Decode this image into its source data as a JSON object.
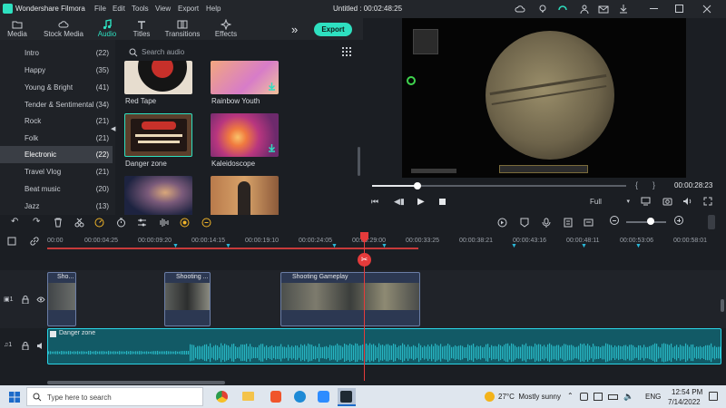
{
  "app": {
    "name": "Wondershare Filmora",
    "menu": [
      "File",
      "Edit",
      "Tools",
      "View",
      "Export",
      "Help"
    ],
    "project_title": "Untitled : 00:02:48:25"
  },
  "tabs": [
    {
      "label": "Media",
      "icon": "folder-icon"
    },
    {
      "label": "Stock Media",
      "icon": "cloud-icon"
    },
    {
      "label": "Audio",
      "icon": "music-note-icon"
    },
    {
      "label": "Titles",
      "icon": "text-icon"
    },
    {
      "label": "Transitions",
      "icon": "transition-icon"
    },
    {
      "label": "Effects",
      "icon": "sparkle-icon"
    }
  ],
  "export_label": "Export",
  "search_placeholder": "Search audio",
  "categories": [
    {
      "name": "Intro",
      "count": "(22)"
    },
    {
      "name": "Happy",
      "count": "(35)"
    },
    {
      "name": "Young & Bright",
      "count": "(41)"
    },
    {
      "name": "Tender & Sentimental",
      "count": "(34)"
    },
    {
      "name": "Rock",
      "count": "(21)"
    },
    {
      "name": "Folk",
      "count": "(21)"
    },
    {
      "name": "Electronic",
      "count": "(22)"
    },
    {
      "name": "Travel Vlog",
      "count": "(21)"
    },
    {
      "name": "Beat music",
      "count": "(20)"
    },
    {
      "name": "Jazz",
      "count": "(13)"
    }
  ],
  "audio_items": [
    {
      "label": "Red Tape"
    },
    {
      "label": "Rainbow Youth"
    },
    {
      "label": "Danger zone"
    },
    {
      "label": "Kaleidoscope"
    }
  ],
  "preview": {
    "timecode": "00:00:28:23",
    "quality": "Full",
    "playback_progress": 0.18
  },
  "ruler_ticks": [
    "00:00",
    "00:00:04:25",
    "00:00:09:20",
    "00:00:14:15",
    "00:00:19:10",
    "00:00:24:05",
    "00:00:29:00",
    "00:00:33:25",
    "00:00:38:21",
    "00:00:43:16",
    "00:00:48:11",
    "00:00:53:06",
    "00:00:58:01"
  ],
  "clips": [
    {
      "label": "Sho..."
    },
    {
      "label": "Shooting ..."
    },
    {
      "label": "Shooting Gameplay"
    }
  ],
  "audio_clip_label": "Danger zone",
  "track_labels": {
    "video": "1",
    "audio": "1"
  },
  "taskbar": {
    "search_placeholder": "Type here to search",
    "weather": "27°C  Mostly sunny",
    "lang": "ENG",
    "time": "12:54 PM",
    "date": "7/14/2022"
  },
  "colors": {
    "accent": "#2ee0c0",
    "playhead": "#e53b3b",
    "audio_wave": "#27b6c3"
  }
}
